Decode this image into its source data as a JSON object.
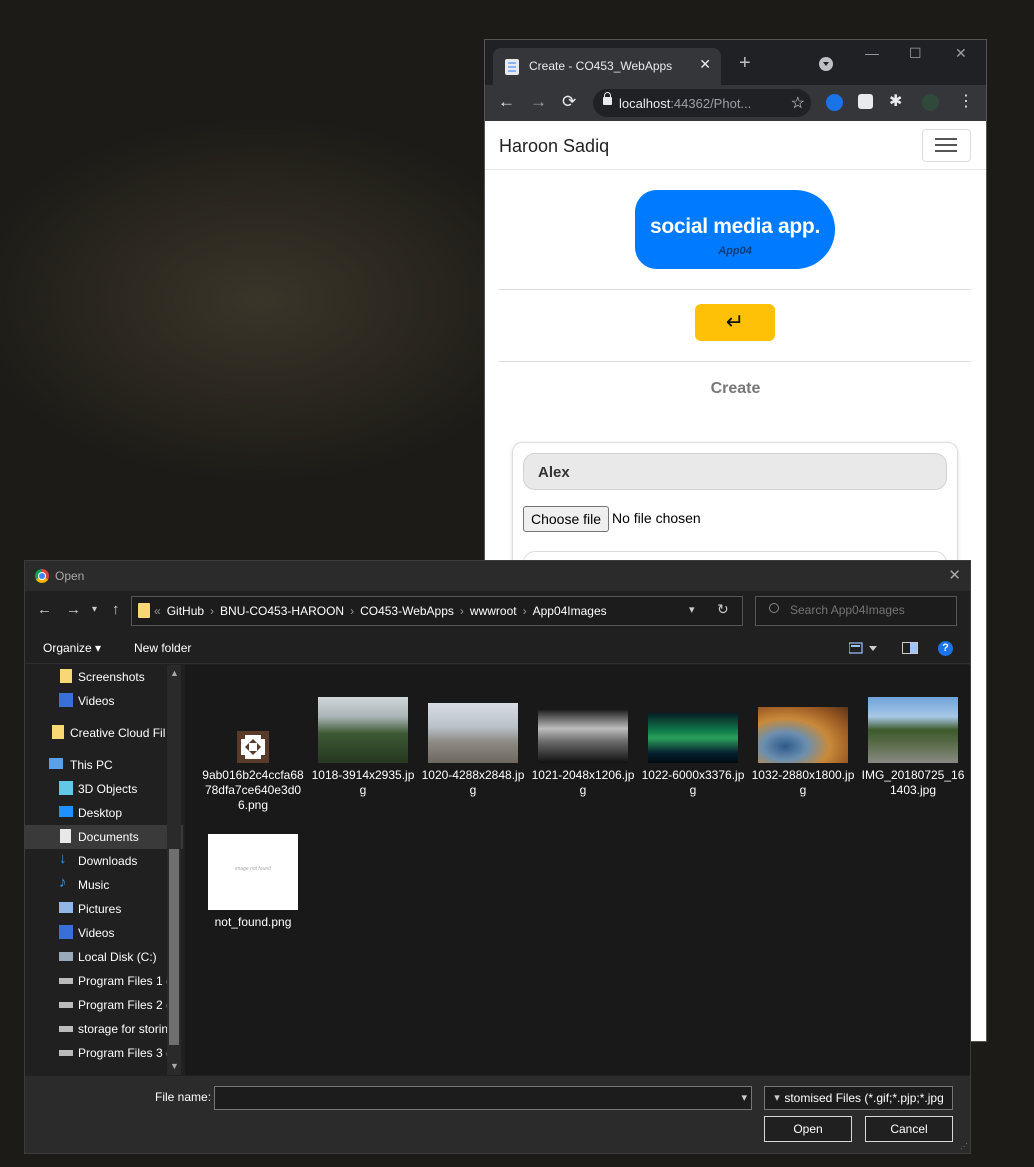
{
  "browser": {
    "tab_title": "Create - CO453_WebApps",
    "tab_close": "✕",
    "new_tab": "+",
    "url_host": "localhost",
    "url_rest": ":44362/Phot...",
    "window_controls": [
      "—",
      "☐",
      "✕"
    ]
  },
  "page": {
    "brand": "Haroon Sadiq",
    "logo_title": "social media app.",
    "logo_subtitle": "App04",
    "back_icon": "↵",
    "heading": "Create",
    "name_value": "Alex",
    "choose_file_label": "Choose file",
    "no_file_text": "No file chosen"
  },
  "dialog": {
    "title": "Open",
    "close": "✕",
    "breadcrumbs": [
      "GitHub",
      "BNU-CO453-HAROON",
      "CO453-WebApps",
      "wwwroot",
      "App04Images"
    ],
    "search_placeholder": "Search App04Images",
    "organize": "Organize ▾",
    "new_folder": "New folder",
    "help": "?",
    "nav_items": [
      {
        "label": "Screenshots",
        "icon": "folder-icon"
      },
      {
        "label": "Videos",
        "icon": "videos-folder-icon"
      },
      {
        "label": "Creative Cloud Fil",
        "icon": "creative-cloud-icon"
      },
      {
        "label": "This PC",
        "icon": "pc-icon"
      },
      {
        "label": "3D Objects",
        "icon": "3d-objects-icon"
      },
      {
        "label": "Desktop",
        "icon": "desktop-icon"
      },
      {
        "label": "Documents",
        "icon": "documents-icon"
      },
      {
        "label": "Downloads",
        "icon": "downloads-icon"
      },
      {
        "label": "Music",
        "icon": "music-icon"
      },
      {
        "label": "Pictures",
        "icon": "pictures-icon"
      },
      {
        "label": "Videos",
        "icon": "videos-folder-icon"
      },
      {
        "label": "Local Disk (C:)",
        "icon": "local-disk-icon"
      },
      {
        "label": "Program Files 1 (",
        "icon": "drive-icon"
      },
      {
        "label": "Program Files 2 (",
        "icon": "drive-icon"
      },
      {
        "label": "storage for storin",
        "icon": "drive-icon"
      },
      {
        "label": "Program Files 3 (",
        "icon": "drive-icon"
      }
    ],
    "files": [
      {
        "name": "9ab016b2c4ccfa6878dfa7ce640e3d06.png"
      },
      {
        "name": "1018-3914x2935.jpg"
      },
      {
        "name": "1020-4288x2848.jpg"
      },
      {
        "name": "1021-2048x1206.jpg"
      },
      {
        "name": "1022-6000x3376.jpg"
      },
      {
        "name": "1032-2880x1800.jpg"
      },
      {
        "name": "IMG_20180725_161403.jpg"
      },
      {
        "name": "not_found.png",
        "thumb_text": "image not found"
      }
    ],
    "file_name_label": "File name:",
    "file_name_value": "",
    "file_type": "Customised Files (*.gif;*.pjp;*.jpg",
    "open_button": "Open",
    "cancel_button": "Cancel"
  },
  "colors": {
    "accent_blue": "#007bff",
    "warning_yellow": "#ffc107",
    "dialog_bg": "#202020"
  }
}
